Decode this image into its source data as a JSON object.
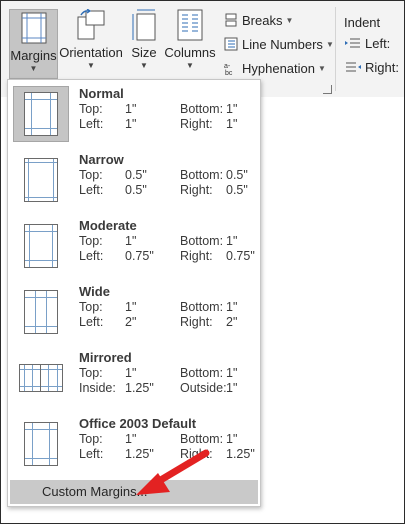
{
  "ribbon": {
    "margins_label": "Margins",
    "orientation_label": "Orientation",
    "size_label": "Size",
    "columns_label": "Columns",
    "breaks_label": "Breaks",
    "line_numbers_label": "Line Numbers",
    "hyphenation_label": "Hyphenation",
    "indent_title": "Indent",
    "indent_left_label": "Left:",
    "indent_right_label": "Right:"
  },
  "margins_menu": {
    "presets": [
      {
        "name": "Normal",
        "top_label": "Top:",
        "top": "1\"",
        "bottom_label": "Bottom:",
        "bottom": "1\"",
        "left_label": "Left:",
        "left": "1\"",
        "right_label": "Right:",
        "right": "1\""
      },
      {
        "name": "Narrow",
        "top_label": "Top:",
        "top": "0.5\"",
        "bottom_label": "Bottom:",
        "bottom": "0.5\"",
        "left_label": "Left:",
        "left": "0.5\"",
        "right_label": "Right:",
        "right": "0.5\""
      },
      {
        "name": "Moderate",
        "top_label": "Top:",
        "top": "1\"",
        "bottom_label": "Bottom:",
        "bottom": "1\"",
        "left_label": "Left:",
        "left": "0.75\"",
        "right_label": "Right:",
        "right": "0.75\""
      },
      {
        "name": "Wide",
        "top_label": "Top:",
        "top": "1\"",
        "bottom_label": "Bottom:",
        "bottom": "1\"",
        "left_label": "Left:",
        "left": "2\"",
        "right_label": "Right:",
        "right": "2\""
      },
      {
        "name": "Mirrored",
        "top_label": "Top:",
        "top": "1\"",
        "bottom_label": "Bottom:",
        "bottom": "1\"",
        "left_label": "Inside:",
        "left": "1.25\"",
        "right_label": "Outside:",
        "right": "1\""
      },
      {
        "name": "Office 2003 Default",
        "top_label": "Top:",
        "top": "1\"",
        "bottom_label": "Bottom:",
        "bottom": "1\"",
        "left_label": "Left:",
        "left": "1.25\"",
        "right_label": "Right:",
        "right": "1.25\""
      }
    ],
    "selected_preset": "Normal",
    "custom_margins_label": "Custom Margins..."
  },
  "colors": {
    "accent_arrow": "#e32222",
    "selected_bg": "#c5c5c5",
    "margin_guides": "#7aa0c8"
  }
}
